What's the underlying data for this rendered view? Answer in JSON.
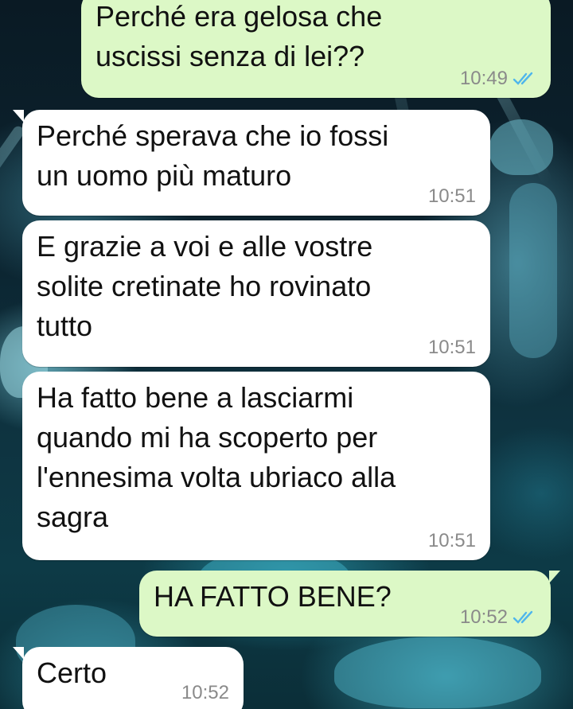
{
  "colors": {
    "incoming_bubble": "#ffffff",
    "outgoing_bubble": "#dcf8c6",
    "timestamp": "#8a8a8a",
    "read_ticks": "#4fb6ec"
  },
  "messages": [
    {
      "direction": "outgoing",
      "text": "Perché era gelosa che\nuscissi senza di lei??",
      "time": "10:49",
      "status_icon": "double-check-read-icon"
    },
    {
      "direction": "incoming",
      "text": "Perché sperava che io fossi\nun uomo più maturo",
      "time": "10:51"
    },
    {
      "direction": "incoming",
      "text": "E grazie a voi e alle vostre\nsolite cretinate ho rovinato\ntutto",
      "time": "10:51"
    },
    {
      "direction": "incoming",
      "text": "Ha fatto bene a lasciarmi\nquando mi ha scoperto per\nl'ennesima volta ubriaco alla\nsagra",
      "time": "10:51"
    },
    {
      "direction": "outgoing",
      "text": "HA FATTO BENE?",
      "time": "10:52",
      "status_icon": "double-check-read-icon"
    },
    {
      "direction": "incoming",
      "text": "Certo",
      "time": "10:52"
    }
  ]
}
